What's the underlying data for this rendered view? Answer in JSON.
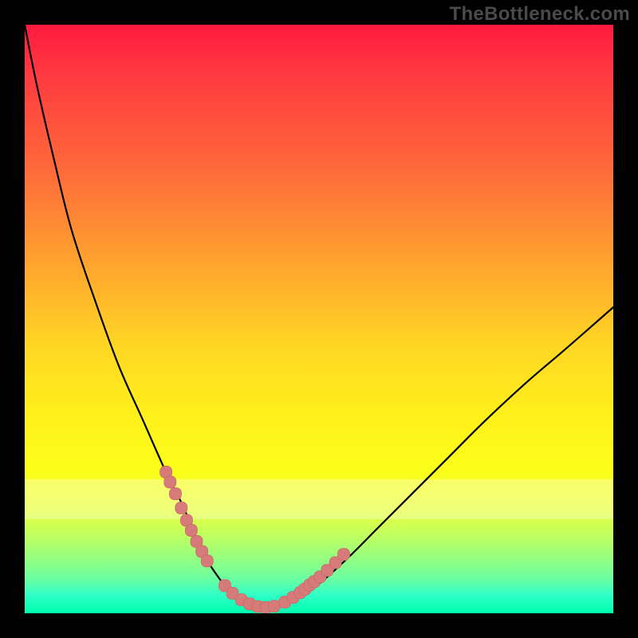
{
  "watermark": "TheBottleneck.com",
  "colors": {
    "frame": "#000000",
    "watermark": "#4a4a4a",
    "curve": "#000000",
    "marker_fill": "#d77a7a",
    "marker_stroke": "#c86a6a"
  },
  "chart_data": {
    "type": "line",
    "title": "",
    "xlabel": "",
    "ylabel": "",
    "xlim": [
      0,
      100
    ],
    "ylim": [
      0,
      100
    ],
    "grid": false,
    "legend": false,
    "series": [
      {
        "name": "bottleneck-curve",
        "x": [
          0,
          2,
          5,
          8,
          12,
          16,
          20,
          24,
          27,
          29,
          31,
          33,
          35,
          37,
          39,
          41,
          43,
          46,
          50,
          55,
          60,
          66,
          72,
          78,
          85,
          92,
          100
        ],
        "y": [
          100,
          90,
          77,
          65,
          53,
          42,
          33,
          24,
          18,
          13,
          9,
          6,
          3.5,
          2,
          1.2,
          1,
          1.3,
          2.4,
          5,
          9.5,
          14.5,
          20.5,
          26.5,
          32.5,
          39,
          45,
          52
        ]
      }
    ],
    "markers": {
      "name": "highlight-points",
      "x": [
        24.0,
        24.7,
        25.6,
        26.6,
        27.5,
        28.3,
        29.2,
        30.1,
        31.0,
        34.0,
        35.3,
        36.8,
        38.2,
        39.6,
        41.0,
        42.4,
        44.2,
        45.6,
        46.8,
        47.6,
        48.4,
        49.2,
        50.2,
        51.4,
        52.8,
        54.2
      ],
      "y": [
        24.0,
        22.3,
        20.3,
        17.9,
        15.8,
        14.1,
        12.2,
        10.5,
        8.9,
        4.7,
        3.4,
        2.3,
        1.6,
        1.15,
        1.0,
        1.2,
        1.9,
        2.7,
        3.5,
        4.1,
        4.8,
        5.4,
        6.2,
        7.3,
        8.6,
        10.0
      ]
    },
    "marker_style": {
      "shape": "rounded-square",
      "size": 15
    }
  }
}
